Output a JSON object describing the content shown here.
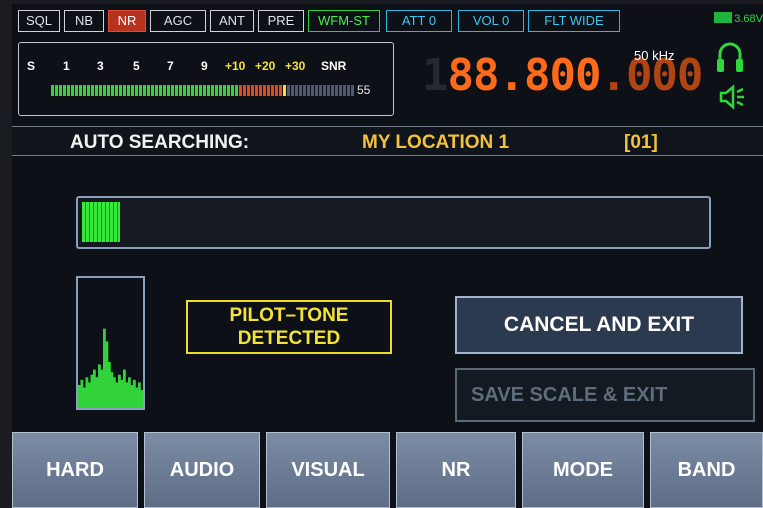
{
  "top_buttons": [
    {
      "label": "SQL",
      "style": "normal"
    },
    {
      "label": "NB",
      "style": "normal"
    },
    {
      "label": "NR",
      "style": "red"
    },
    {
      "label": "AGC",
      "style": "normal"
    },
    {
      "label": "ANT",
      "style": "normal"
    },
    {
      "label": "PRE",
      "style": "normal"
    },
    {
      "label": "WFM-ST",
      "style": "green"
    },
    {
      "label": "ATT 0",
      "style": "cyan"
    },
    {
      "label": "VOL 0",
      "style": "cyan"
    },
    {
      "label": "FLT WIDE",
      "style": "cyan"
    }
  ],
  "battery_label": "3.68V",
  "meter": {
    "scale": [
      {
        "label": "S",
        "color": "#ffffff"
      },
      {
        "label": "1",
        "color": "#ffffff"
      },
      {
        "label": "3",
        "color": "#ffffff"
      },
      {
        "label": "5",
        "color": "#ffffff"
      },
      {
        "label": "7",
        "color": "#ffffff"
      },
      {
        "label": "9",
        "color": "#ffffff"
      },
      {
        "label": "+10",
        "color": "#f2e23a"
      },
      {
        "label": "+20",
        "color": "#f2e23a"
      },
      {
        "label": "+30",
        "color": "#f2e23a"
      },
      {
        "label": "SNR",
        "color": "#ffffff"
      }
    ],
    "snr_value": "55",
    "green_level": 0.62,
    "red_level": 0.15,
    "colors": {
      "green": "#2fd73a",
      "red": "#e34a1c",
      "yellow": "#f2e23a",
      "empty": "#4e5a74"
    }
  },
  "frequency": {
    "ghost": "1",
    "main": "88.800",
    "fraction": ".000",
    "step": "50 kHz"
  },
  "search": {
    "label": "AUTO SEARCHING:",
    "location": "MY LOCATION 1",
    "index": "[01]"
  },
  "progress_fraction": 0.06,
  "pilot_text": [
    "PILOT–TONE",
    "DETECTED"
  ],
  "cancel_button": "CANCEL  AND  EXIT",
  "save_button": "SAVE SCALE & EXIT",
  "tabs": [
    "HARD",
    "AUDIO",
    "VISUAL",
    "NR",
    "MODE",
    "BAND"
  ],
  "spectrum_levels": [
    0.18,
    0.22,
    0.16,
    0.24,
    0.2,
    0.26,
    0.3,
    0.24,
    0.34,
    0.3,
    0.62,
    0.52,
    0.36,
    0.28,
    0.24,
    0.2,
    0.26,
    0.22,
    0.3,
    0.2,
    0.24,
    0.18,
    0.22,
    0.16,
    0.2,
    0.14
  ]
}
